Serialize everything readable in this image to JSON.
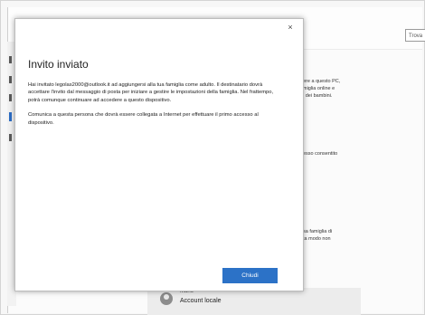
{
  "background": {
    "search_placeholder": "Trova",
    "side_texts": [
      "ere a questo PC,",
      "miglia online e",
      "i dei bambini.",
      "esso consentito",
      "sa famiglia di",
      "ta modo non"
    ],
    "account": {
      "name": "Mario",
      "type": "Account locale"
    }
  },
  "dialog": {
    "close_glyph": "×",
    "title": "Invito inviato",
    "paragraphs": [
      "Hai invitato legolas2000@outlook.it ad aggiungersi alla tua famiglia come adulto. Il destinatario dovrà accettare l'invito dal messaggio di posta per iniziare a gestire le impostazioni della famiglia. Nel frattempo, potrà comunque continuare ad accedere a questo dispositivo.",
      "Comunica a questa persona che dovrà essere collegata a Internet per effettuare il primo accesso al dispositivo."
    ],
    "primary_button": "Chiudi"
  },
  "colors": {
    "accent": "#2c72c7",
    "dialog_bg": "#ffffff",
    "page_bg": "#f7f7f7"
  }
}
